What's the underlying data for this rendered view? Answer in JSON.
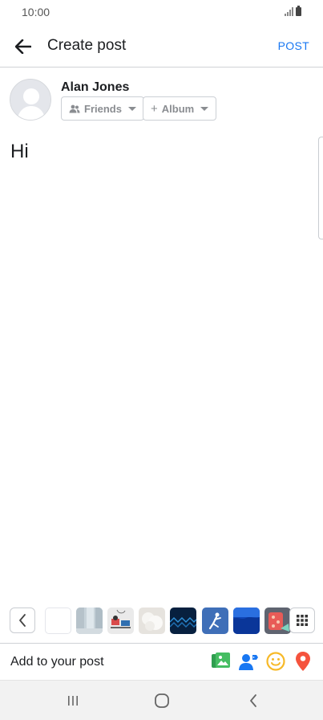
{
  "status_bar": {
    "time": "10:00"
  },
  "header": {
    "title": "Create post",
    "post_label": "POST"
  },
  "composer": {
    "user_name": "Alan Jones",
    "audience_label": "Friends",
    "album_label": "Album",
    "text": "Hi"
  },
  "thumbnails": [
    {
      "name": "thumb-blank",
      "color": "#ffffff"
    },
    {
      "name": "thumb-waterfall",
      "color": "#c8d3da"
    },
    {
      "name": "thumb-drawing",
      "color": "#eaeaea"
    },
    {
      "name": "thumb-cotton",
      "color": "#e6e3de"
    },
    {
      "name": "thumb-blue-pattern",
      "color": "#07203f"
    },
    {
      "name": "thumb-skier",
      "color": "#3f6fb8"
    },
    {
      "name": "thumb-ocean",
      "color": "#0f46b8"
    },
    {
      "name": "thumb-pattern",
      "color": "#5f6470"
    }
  ],
  "add_to_post": {
    "label": "Add to your post",
    "icons": [
      "photo-video-icon",
      "tag-people-icon",
      "feeling-icon",
      "location-icon"
    ]
  },
  "colors": {
    "accent": "#1877f2",
    "photo": "#45bd62",
    "tag": "#1877f2",
    "feeling": "#f7b928",
    "location": "#f5533d"
  },
  "nav_bar": {
    "buttons": [
      "recent-apps-icon",
      "home-icon",
      "back-icon"
    ]
  }
}
